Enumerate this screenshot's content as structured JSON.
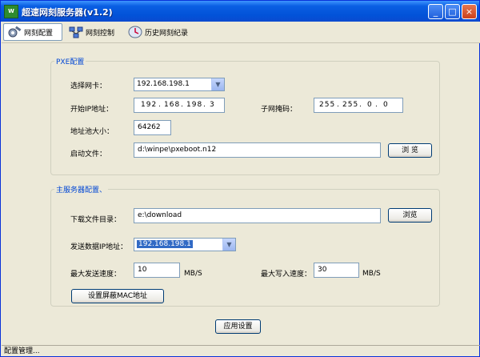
{
  "window": {
    "title": "超速网刻服务器(v1.2)",
    "controls": {
      "minimize": "_",
      "maximize": "□",
      "close": "×"
    }
  },
  "toolbar": {
    "tabs": [
      {
        "label": "网刻配置",
        "icon": "gear-icon",
        "active": true
      },
      {
        "label": "网刻控制",
        "icon": "network-icon",
        "active": false
      },
      {
        "label": "历史网刻纪录",
        "icon": "history-icon",
        "active": false
      }
    ]
  },
  "pxe": {
    "legend": "PXE配置",
    "nic_label": "选择网卡：",
    "nic_value": "192.168.198.1",
    "start_ip_label": "开始IP地址：",
    "start_ip": [
      "192",
      "168",
      "198",
      "3"
    ],
    "subnet_label": "子网掩码：",
    "subnet": [
      "255",
      "255",
      "0",
      "0"
    ],
    "pool_size_label": "地址池大小：",
    "pool_size": "64262",
    "boot_file_label": "启动文件：",
    "boot_file": "d:\\winpe\\pxeboot.n12",
    "browse_label": "浏 览"
  },
  "server": {
    "legend": "主服务器配置、",
    "download_dir_label": "下载文件目录：",
    "download_dir": "e:\\download",
    "browse_label": "浏览",
    "send_ip_label": "发送数据IP地址：",
    "send_ip": "192.168.198.1",
    "max_send_label": "最大发送速度：",
    "max_send": "10",
    "max_send_unit": "MB/S",
    "max_write_label": "最大写入速度：",
    "max_write": "30",
    "max_write_unit": "MB/S",
    "mac_button": "设置屏蔽MAC地址"
  },
  "apply_button": "应用设置",
  "status": "配置管理..."
}
